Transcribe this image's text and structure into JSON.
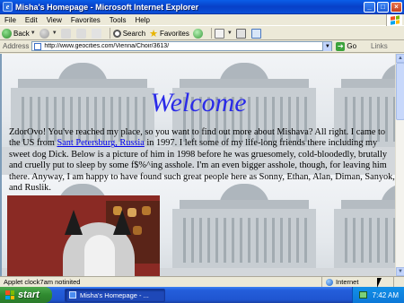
{
  "window": {
    "title": "Misha's Homepage - Microsoft Internet Explorer",
    "minimize": "_",
    "maximize": "□",
    "close": "×"
  },
  "menubar": {
    "items": [
      "File",
      "Edit",
      "View",
      "Favorites",
      "Tools",
      "Help"
    ]
  },
  "toolbar": {
    "back_label": "Back",
    "search_label": "Search",
    "favorites_label": "Favorites"
  },
  "address": {
    "label": "Address",
    "url": "http://www.geocities.com/Vienna/Choir/3613/",
    "go_label": "Go",
    "links_label": "Links"
  },
  "page": {
    "heading": "Welcome",
    "text_before_link": "ZdorOvo! You've reached my place, so you want to find out more about Mishava? All right. I came to the US from ",
    "link_text": "Sant Petersburg, Russia",
    "text_after_link": " in 1997. I left some of my life-long friends there including my sweet dog Dick. Below is a picture of him in 1998 before he was gruesomely, cold-bloodedly, brutally and cruelly put to sleep by some f$%^ing asshole. I'm an even bigger asshole, though, for leaving him there. Anyway, I am happy to have found such great people here as Sonny, Ethan, Alan, Diman, Sanyok, and Ruslik."
  },
  "statusbar": {
    "message": "Applet clock7am notinited",
    "zone": "Internet"
  },
  "taskbar": {
    "start_label": "start",
    "task_label": "Misha's Homepage - ...",
    "clock": "7:42 AM"
  },
  "colors": {
    "heading": "#2a2ae8",
    "link": "#0000ee",
    "titlebar": "#0a50d8",
    "start": "#2f8a2f"
  },
  "icons": [
    "ie-icon",
    "windows-flag-icon",
    "back-arrow-icon",
    "forward-arrow-icon",
    "stop-icon",
    "refresh-icon",
    "home-icon",
    "search-icon",
    "favorites-star-icon",
    "history-icon",
    "mail-icon",
    "print-icon",
    "go-arrow-icon",
    "globe-icon"
  ]
}
